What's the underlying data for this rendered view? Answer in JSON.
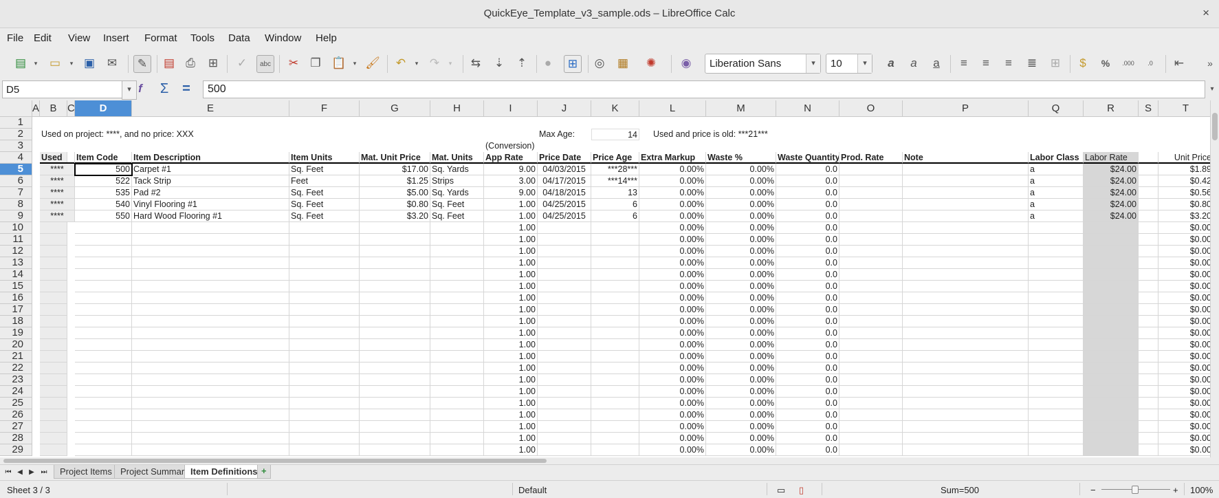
{
  "window": {
    "title": "QuickEye_Template_v3_sample.ods – LibreOffice Calc",
    "close": "×"
  },
  "menu": [
    "File",
    "Edit",
    "View",
    "Insert",
    "Format",
    "Tools",
    "Data",
    "Window",
    "Help"
  ],
  "toolbar": {
    "font_name": "Liberation Sans",
    "font_size": "10",
    "percent": "%",
    "dec_add": ".000",
    "dec_del": ".0",
    "more": "»"
  },
  "formula": {
    "cell_ref": "D5",
    "value": "500"
  },
  "columns": [
    "A",
    "B",
    "C",
    "D",
    "E",
    "F",
    "G",
    "H",
    "I",
    "J",
    "K",
    "L",
    "M",
    "N",
    "O",
    "P",
    "Q",
    "R",
    "S",
    "T"
  ],
  "rows": [
    "1",
    "2",
    "3",
    "4",
    "5",
    "6",
    "7",
    "8",
    "9",
    "10",
    "11",
    "12",
    "13",
    "14",
    "15",
    "16",
    "17",
    "18",
    "19",
    "20",
    "21",
    "22",
    "23",
    "24",
    "25",
    "26",
    "27",
    "28",
    "29"
  ],
  "notes": {
    "used_note": "Used on project: ****, and no price: XXX",
    "max_age_label": "Max Age:",
    "max_age_value": "14",
    "old_note": "Used and price is old: ***21***",
    "conversion": "(Conversion)"
  },
  "headers": [
    "Used",
    "Item Code",
    "Item Description",
    "Item Units",
    "Mat. Unit Price",
    "Mat. Units",
    "App Rate",
    "Price Date",
    "Price Age",
    "Extra Markup",
    "Waste %",
    "Waste Quantity",
    "Prod. Rate",
    "Note",
    "Labor Class",
    "Labor Rate",
    "Unit Price"
  ],
  "data_rows": [
    [
      "****",
      "500",
      "Carpet #1",
      "Sq. Feet",
      "$17.00",
      "Sq. Yards",
      "9.00",
      "04/03/2015",
      "***28***",
      "0.00%",
      "0.00%",
      "0.0",
      "",
      "",
      "a",
      "$24.00",
      "$1.89"
    ],
    [
      "****",
      "522",
      "Tack Strip",
      "Feet",
      "$1.25",
      "Strips",
      "3.00",
      "04/17/2015",
      "***14***",
      "0.00%",
      "0.00%",
      "0.0",
      "",
      "",
      "a",
      "$24.00",
      "$0.42"
    ],
    [
      "****",
      "535",
      "Pad #2",
      "Sq. Feet",
      "$5.00",
      "Sq. Yards",
      "9.00",
      "04/18/2015",
      "13",
      "0.00%",
      "0.00%",
      "0.0",
      "",
      "",
      "a",
      "$24.00",
      "$0.56"
    ],
    [
      "****",
      "540",
      "Vinyl  Flooring  #1",
      "Sq. Feet",
      "$0.80",
      "Sq. Feet",
      "1.00",
      "04/25/2015",
      "6",
      "0.00%",
      "0.00%",
      "0.0",
      "",
      "",
      "a",
      "$24.00",
      "$0.80"
    ],
    [
      "****",
      "550",
      "Hard Wood Flooring  #1",
      "Sq. Feet",
      "$3.20",
      "Sq. Feet",
      "1.00",
      "04/25/2015",
      "6",
      "0.00%",
      "0.00%",
      "0.0",
      "",
      "",
      "a",
      "$24.00",
      "$3.20"
    ]
  ],
  "empty_row": {
    "app_rate": "1.00",
    "extra_markup": "0.00%",
    "waste": "0.00%",
    "waste_qty": "0.0",
    "unit_price": "$0.00"
  },
  "tabs": [
    "Project Items",
    "Project Summary",
    "Item Definitions"
  ],
  "tab_add": "+",
  "status": {
    "sheet": "Sheet 3 / 3",
    "style": "Default",
    "sum": "Sum=500",
    "zoom": "100%",
    "zoom_minus": "−",
    "zoom_plus": "+"
  }
}
